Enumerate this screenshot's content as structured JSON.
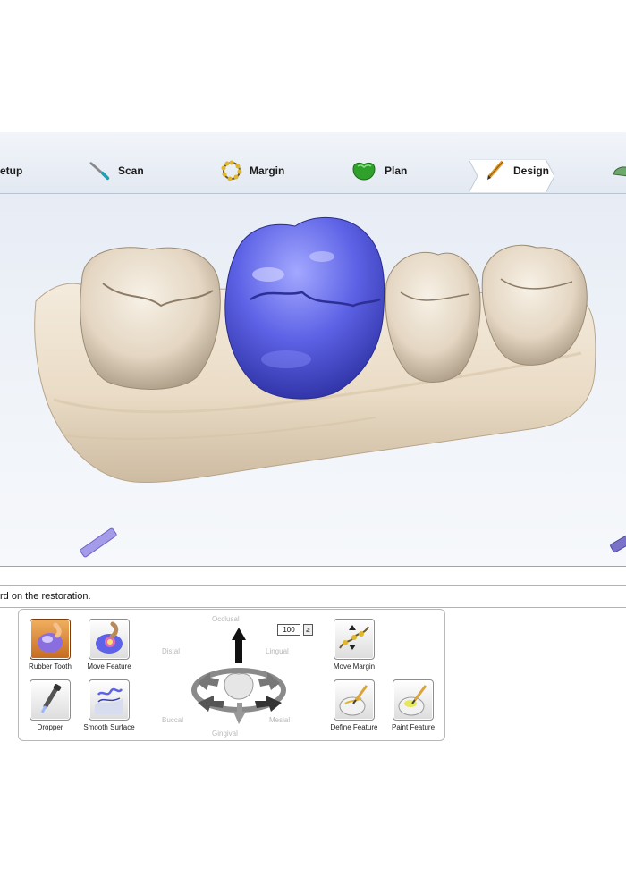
{
  "workflow": {
    "steps": [
      {
        "label": "etup",
        "icon": "setup-icon"
      },
      {
        "label": "Scan",
        "icon": "scan-wand-icon"
      },
      {
        "label": "Margin",
        "icon": "margin-ring-icon"
      },
      {
        "label": "Plan",
        "icon": "plan-tooth-icon"
      },
      {
        "label": "Design",
        "icon": "design-pencil-icon",
        "active": true
      }
    ]
  },
  "status_text": "rd on the restoration.",
  "tools": {
    "rubber_tooth": "Rubber Tooth",
    "move_feature": "Move Feature",
    "dropper": "Dropper",
    "smooth_surface": "Smooth Surface",
    "move_margin": "Move Margin",
    "define_feature": "Define Feature",
    "paint_feature": "Paint Feature"
  },
  "orientation": {
    "occlusal": "Occlusal",
    "distal": "Distal",
    "lingual": "Lingual",
    "buccal": "Buccal",
    "mesial": "Mesial",
    "gingival": "Gingival"
  },
  "zoom": {
    "value": "100",
    "button": "≥"
  },
  "colors": {
    "restoration": "#5b5ee0",
    "tooth": "#e8dccb",
    "gum_model": "#efe4d2",
    "active_tool": "#d98a3a"
  }
}
